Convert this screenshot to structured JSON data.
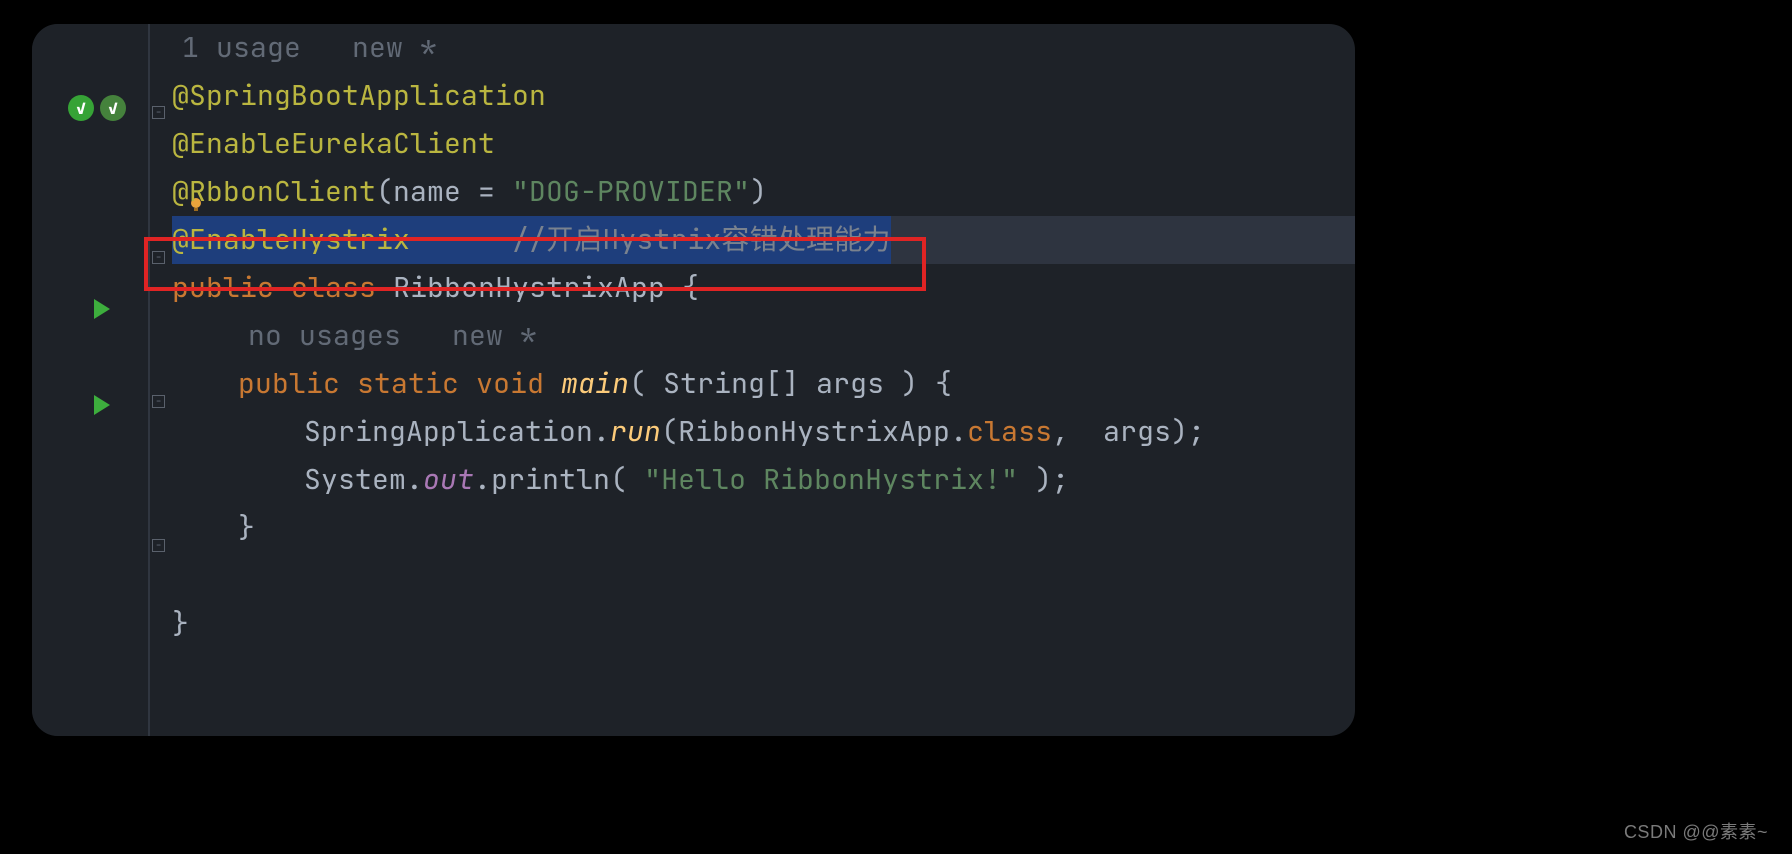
{
  "hints": {
    "usage_top": "1 usage   new *",
    "usage_inner": "no usages   new *"
  },
  "annotations": {
    "spring_boot": "@SpringBootApplication",
    "enable_eureka": "@EnableEurekaClient",
    "ribbon_client_prefix": "@R",
    "ribbon_client_suffix": "bbonClient",
    "ribbon_client_args_open": "(name = ",
    "ribbon_client_args_close": ")",
    "ribbon_name_value": "\"DOG-PROVIDER\"",
    "enable_hystrix": "@EnableHystrix",
    "enable_hystrix_pad": "      ",
    "enable_hystrix_comment": "//开启Hystrix容错处理能力"
  },
  "decl": {
    "public": "public",
    "class": "class",
    "class_name": "RibbonHystrixApp",
    "open_brace": " {",
    "static": "static",
    "void": "void",
    "main": "main",
    "main_args_open": "( ",
    "main_args_type": "String[]",
    "main_args_name": " args",
    "main_args_close": " ) {"
  },
  "body": {
    "spring_app": "SpringApplication",
    "dot": ".",
    "run": "run",
    "open_paren": "(",
    "ribbon_cls": "RibbonHystrixApp",
    "class_kw": "class",
    "comma_args": ",  args);",
    "system": "System",
    "out": "out",
    "println": "println",
    "println_open": "( ",
    "hello_str": "\"Hello RibbonHystrix!\"",
    "println_close": " );",
    "close_brace": "}"
  },
  "icons": {
    "check1": "spring-run-icon",
    "check2": "spring-run-config-icon",
    "bulb": "intention-bulb-icon"
  },
  "watermark": "CSDN @@素素~"
}
